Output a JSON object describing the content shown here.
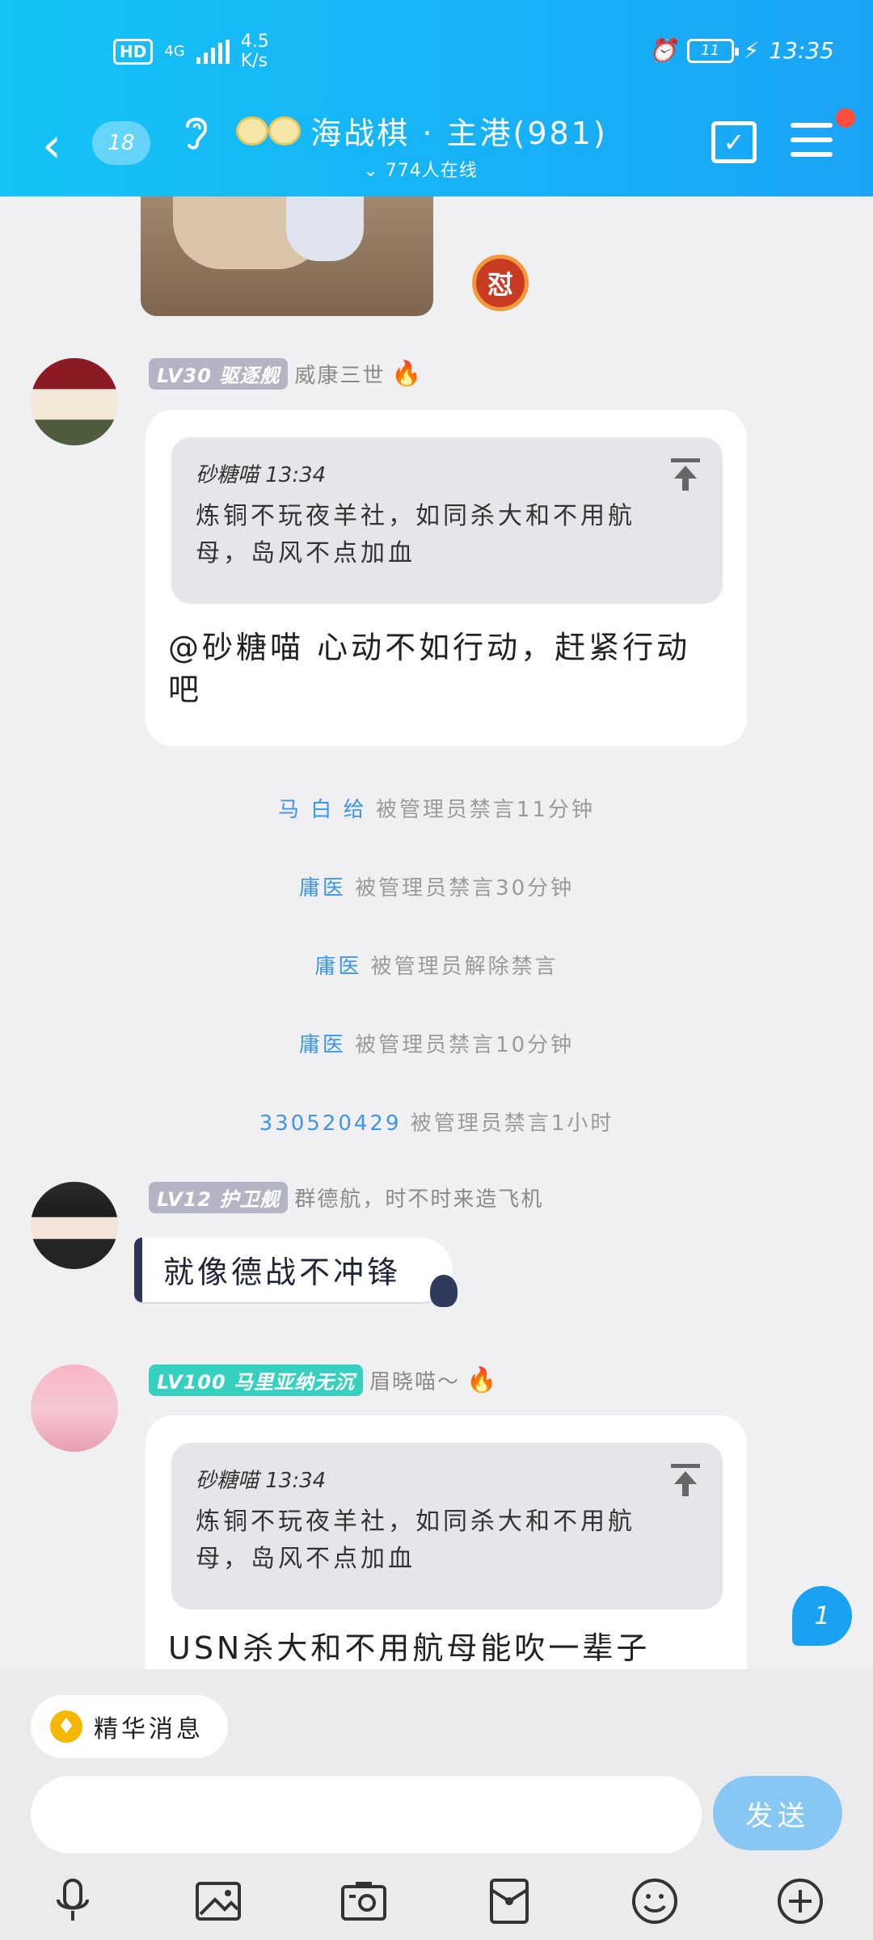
{
  "status_bar": {
    "hd": "HD",
    "network": "4G",
    "speed_value": "4.5",
    "speed_unit": "K/s",
    "battery": "11",
    "time": "13:35"
  },
  "header": {
    "unread_count": "18",
    "title": "海战棋 · 主港(981)",
    "online": "774人在线",
    "notification_dot": true
  },
  "messages": [
    {
      "level": "LV30 驱逐舰",
      "nickname": "威康三世",
      "quote": {
        "author_time": "砂糖喵 13:34",
        "text": "炼铜不玩夜羊社，如同杀大和不用航母，岛风不点加血"
      },
      "text": "@砂糖喵 心动不如行动，赶紧行动吧"
    },
    {
      "level": "LV12 护卫舰",
      "nickname": "群德航，时不时来造飞机",
      "text": "就像德战不冲锋"
    },
    {
      "level": "LV100 马里亚纳无沉",
      "nickname": "眉晓喵～",
      "quote": {
        "author_time": "砂糖喵 13:34",
        "text": "炼铜不玩夜羊社，如同杀大和不用航母，岛风不点加血"
      },
      "text": "USN杀大和不用航母能吹一辈子"
    }
  ],
  "system_notices": [
    {
      "who": "马 白 给",
      "action": "被管理员禁言11分钟"
    },
    {
      "who": "庸医",
      "action": "被管理员禁言30分钟"
    },
    {
      "who": "庸医",
      "action": "被管理员解除禁言"
    },
    {
      "who": "庸医",
      "action": "被管理员禁言10分钟"
    },
    {
      "who": "330520429",
      "action": "被管理员禁言1小时"
    }
  ],
  "rage_badge": "怼",
  "new_message_badge": "1",
  "essence_label": "精华消息",
  "input": {
    "value": "",
    "placeholder": ""
  },
  "send_label": "发送",
  "toolbar_icons": [
    "microphone-icon",
    "image-icon",
    "camera-icon",
    "red-packet-icon",
    "emoji-icon",
    "plus-icon"
  ],
  "colors": {
    "header_start": "#14c3f7",
    "header_end": "#1aa4f5",
    "link_blue": "#3d96e6",
    "level_grey": "#b3b5c5",
    "level_teal": "#35d0c0",
    "send_button": "#86c8f3",
    "notification_red": "#ff4d3b"
  }
}
